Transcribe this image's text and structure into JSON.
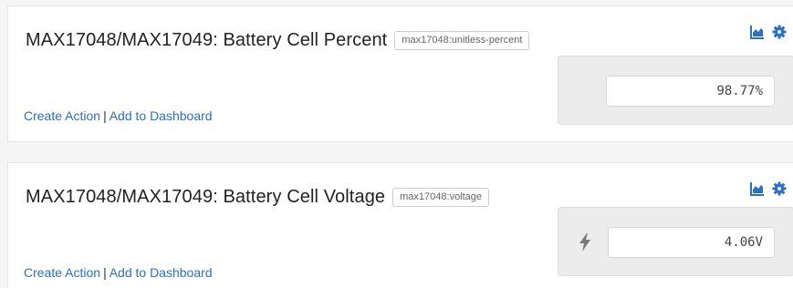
{
  "cards": [
    {
      "title": "MAX17048/MAX17049: Battery Cell Percent",
      "tag": "max17048:unitless-percent",
      "value": "98.77%",
      "create_action": "Create Action",
      "separator": "|",
      "add_to_dashboard": "Add to Dashboard",
      "icons": [
        "chart-icon",
        "gear-icon"
      ]
    },
    {
      "title": "MAX17048/MAX17049: Battery Cell Voltage",
      "tag": "max17048:voltage",
      "value": "4.06V",
      "create_action": "Create Action",
      "separator": "|",
      "add_to_dashboard": "Add to Dashboard",
      "icons": [
        "chart-icon",
        "gear-icon",
        "bolt-icon"
      ]
    }
  ],
  "colors": {
    "link": "#2a6fc9",
    "icon": "#2a6fc9",
    "panel": "#ececec"
  }
}
